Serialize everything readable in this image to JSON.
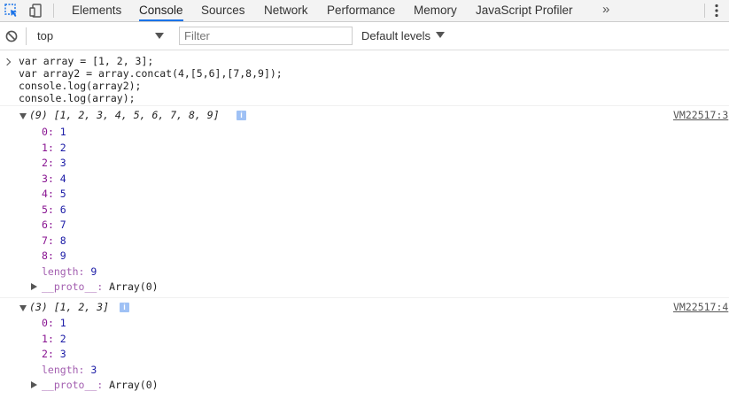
{
  "tabbar": {
    "tabs": [
      {
        "label": "Elements"
      },
      {
        "label": "Console",
        "active": true
      },
      {
        "label": "Sources"
      },
      {
        "label": "Network"
      },
      {
        "label": "Performance"
      },
      {
        "label": "Memory"
      },
      {
        "label": "JavaScript Profiler"
      }
    ],
    "more": "»",
    "accent_color": "#1a73e8"
  },
  "toolbar": {
    "context": "top",
    "filter_placeholder": "Filter",
    "levels": "Default levels"
  },
  "console": {
    "command_lines": [
      "var array = [1, 2, 3];",
      "var array2 = array.concat(4,[5,6],[7,8,9]);",
      "console.log(array2);",
      "console.log(array);"
    ],
    "messages": [
      {
        "summary": "(9) [1, 2, 3, 4, 5, 6, 7, 8, 9]",
        "source": "VM22517:3",
        "entries": [
          {
            "key": "0",
            "value": "1"
          },
          {
            "key": "1",
            "value": "2"
          },
          {
            "key": "2",
            "value": "3"
          },
          {
            "key": "3",
            "value": "4"
          },
          {
            "key": "4",
            "value": "5"
          },
          {
            "key": "5",
            "value": "6"
          },
          {
            "key": "6",
            "value": "7"
          },
          {
            "key": "7",
            "value": "8"
          },
          {
            "key": "8",
            "value": "9"
          }
        ],
        "length_key": "length",
        "length_value": "9",
        "proto_key": "__proto__",
        "proto_value": "Array(0)"
      },
      {
        "summary": "(3) [1, 2, 3]",
        "source": "VM22517:4",
        "entries": [
          {
            "key": "0",
            "value": "1"
          },
          {
            "key": "1",
            "value": "2"
          },
          {
            "key": "2",
            "value": "3"
          }
        ],
        "length_key": "length",
        "length_value": "3",
        "proto_key": "__proto__",
        "proto_value": "Array(0)"
      }
    ]
  },
  "colors": {
    "property_key": "#881391",
    "number_value": "#1a1aa6",
    "info_badge": "#9fc1f5"
  }
}
